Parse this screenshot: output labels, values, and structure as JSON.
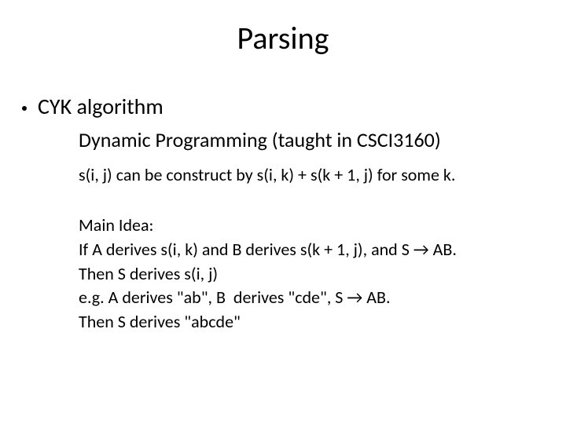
{
  "title": "Parsing",
  "bullet": "CYK algorithm",
  "sub_dp": "Dynamic Programming (taught in CSCI3160)",
  "sub_construct": "s(i, j) can be construct by s(i, k) + s(k + 1, j) for some k.",
  "idea": {
    "l1": "Main Idea:",
    "l2": "If A derives s(i, k) and B derives s(k + 1, j), and S → AB.",
    "l3": "Then S derives s(i, j)",
    "l4": "e.g. A derives \"ab\", B  derives \"cde\", S → AB.",
    "l5": "Then S derives \"abcde\""
  }
}
